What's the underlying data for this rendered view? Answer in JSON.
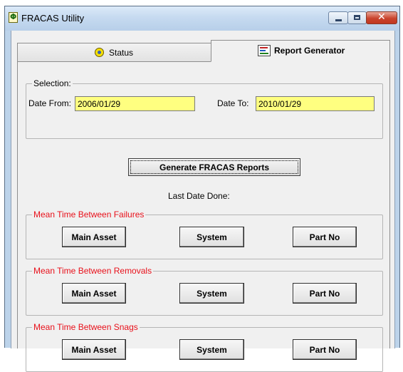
{
  "window": {
    "title": "FRACAS Utility"
  },
  "tabs": [
    {
      "label": "Status",
      "icon": "status-icon"
    },
    {
      "label": "Report Generator",
      "icon": "report-icon",
      "selected": true
    }
  ],
  "selection": {
    "legend": "Selection:",
    "date_from_label": "Date From:",
    "date_from_value": "2006/01/29",
    "date_to_label": "Date To:",
    "date_to_value": "2010/01/29"
  },
  "generate_button": "Generate FRACAS Reports",
  "last_date_label": "Last Date Done:",
  "groups": [
    {
      "legend": "Mean Time Between Failures",
      "buttons": [
        "Main Asset",
        "System",
        "Part No"
      ]
    },
    {
      "legend": "Mean Time Between Removals",
      "buttons": [
        "Main Asset",
        "System",
        "Part No"
      ]
    },
    {
      "legend": "Mean Time Between Snags",
      "buttons": [
        "Main Asset",
        "System",
        "Part No"
      ]
    }
  ],
  "colors": {
    "input_background": "#ffff80",
    "group_legend": "#e8101a",
    "window_frame": "#bcd3ea",
    "close_button": "#c9442d"
  }
}
